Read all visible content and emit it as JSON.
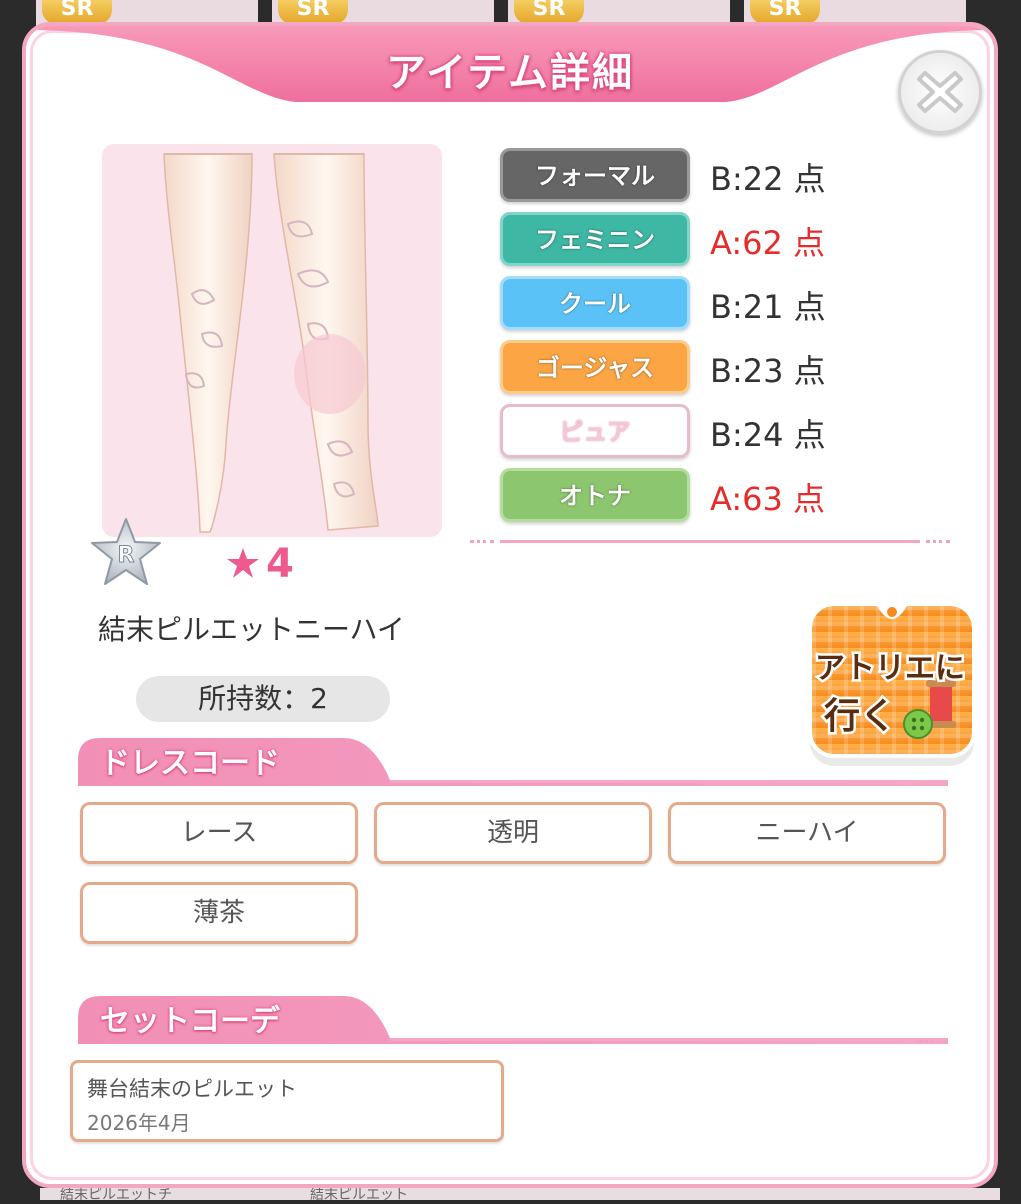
{
  "background": {
    "badges": [
      "SR",
      "SR",
      "SR",
      "SR"
    ],
    "bottom_labels": [
      "結末ピルエットチ",
      "結末ピルエット"
    ]
  },
  "modal": {
    "title": "アイテム詳細",
    "close_icon": "close-x-icon"
  },
  "item": {
    "rarity": "R",
    "star_count": "4",
    "name": "結末ピルエットニーハイ",
    "count_label": "所持数：",
    "count_value": "2"
  },
  "stats": [
    {
      "label": "フォーマル",
      "value": "B:22",
      "unit": "点",
      "color": "#666666",
      "high": false
    },
    {
      "label": "フェミニン",
      "value": "A:62",
      "unit": "点",
      "color": "#3eb7a4",
      "high": true
    },
    {
      "label": "クール",
      "value": "B:21",
      "unit": "点",
      "color": "#5bc2f7",
      "high": false
    },
    {
      "label": "ゴージャス",
      "value": "B:23",
      "unit": "点",
      "color": "#fca544",
      "high": false
    },
    {
      "label": "ピュア",
      "value": "B:24",
      "unit": "点",
      "color": "#ffffff",
      "high": false
    },
    {
      "label": "オトナ",
      "value": "A:63",
      "unit": "点",
      "color": "#8cc66e",
      "high": true
    }
  ],
  "atelier_button": {
    "line1": "アトリエに",
    "line2": "行く"
  },
  "dress_code": {
    "title": "ドレスコード",
    "tags": [
      "レース",
      "透明",
      "ニーハイ",
      "薄茶"
    ]
  },
  "set_coord": {
    "title": "セットコーデ",
    "name": "舞台結末のピルエット",
    "date": "2026年4月"
  },
  "colors": {
    "accent_pink": "#f3a7c2",
    "title_pink": "#ee6b9a",
    "high_score": "#e62b2b",
    "tag_border": "#e5a98c"
  }
}
